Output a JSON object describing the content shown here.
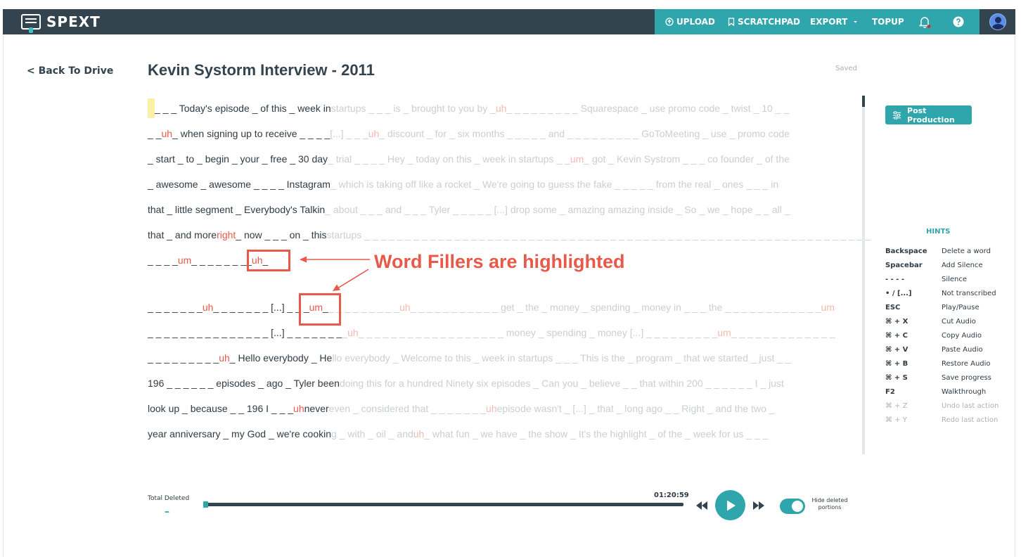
{
  "navbar": {
    "logo_text": "SPEXT",
    "upload_label": "UPLOAD",
    "scratchpad_label": "SCRATCHPAD",
    "export_label": "EXPORT",
    "topup_label": "TOPUP"
  },
  "back_link": "< Back To Drive",
  "doc_title": "Kevin Systorm Interview - 2011",
  "save_status": "Saved",
  "transcript": {
    "line1": {
      "dark": "_ _ _ Today's episode _ of this _ week in",
      "light_pre": " startups _ _ _ is _ brought to you by _ ",
      "filler": "uh",
      "light_post": " _ _ _ _ _ _ _ _ _ Squarespace _ use promo code _ twist _ 10 _ _"
    },
    "line2": {
      "dark_pre": "_ _ ",
      "filler": "uh",
      "dark_post": " _ when signing up to receive _ _ _ _",
      "light_pre": " [...] _ _ _ ",
      "filler_light": "uh",
      "light_post": " _ discount _ for _ six months _ _ _ _ _ and _ _ _ _ _ _ _ _ _ GoToMeeting _ use _ promo code"
    },
    "line3": {
      "dark": "_ start _ to _ begin _ your _ free _ 30 day",
      "light_pre": " _ trial _ _ _ _ Hey _ today on this _ week in startups _ _ ",
      "filler_light": "um",
      "light_post": " _ got _ Kevin Systrom _ _ _ co founder _ of the"
    },
    "line4": {
      "dark": "_ awesome _ awesome _ _ _ _ Instagram",
      "light": " _ which is taking off like a rocket _ We're going to guess the fake _ _ _ _ _ from the real _ ones _ _ _ in"
    },
    "line5": {
      "dark": "that _ little segment _ Everybody's Talkin",
      "light": " _ about _ _ _ and _ _ _ Tyler _ _ _ _ _ [...] drop some _ amazing amazing inside _ So _ we _ hope _ _ all _"
    },
    "line6": {
      "dark_pre": "that _ and more ",
      "filler": "right",
      "dark_post": " _ now _ _ _ on _ this",
      "light": " startups _ _ _ _ _ _ _ _ _ _ _ _ _ _ _ _ _ _ _ _ _ _ _ _ _ _ _ _ _ _ _ _ _ _ _ _ _ _ _ _ _ _ _ _ _ _ _ _ _ _ _ _ _ _ _ _ _ _ _ _ _ _"
    },
    "line7": {
      "dark_pre": "_ _ _ _ ",
      "filler1": "um",
      "dark_mid": " _ _ _ _ _ _ _ ",
      "dark_pre2": "_ ",
      "filler2": "uh",
      "dark_post": " _"
    },
    "line8": {
      "dark_pre": "_ _ _ _ _ _ _ ",
      "filler1": "uh",
      "dark_mid": " _ _ _ _ _ _ _ [...] _ _ _ ",
      "filler2": "um",
      "dark_post": " _",
      "light_pre": " _ _ _ _ _ _ _ _ _ ",
      "filler_light1": "uh",
      "light_mid": " _ _ _ _ _ _ _ _ _ _ _ get _ the _ money _ spending _ money in _ _ _ the _ _ _ _ _ _ _ _ _ _ _ _ ",
      "filler_light2": "um"
    },
    "line9": {
      "dark": "_ _ _ _ _ _ _ _ _ _ _ _ _ _ _ [...] _ _ _ _ _ _ _",
      "light_pre": " _ ",
      "filler_light1": "uh",
      "light_mid": " _ _ _ _ _ _ _ _ _ _ _ _ _ _ _ _ _ _ money _ spending _ money [...] _ _ _ _ _ _ _ _ _ ",
      "filler_light2": "um",
      "light_post": " _ _ _ _ _ _ _ _ _ _ _ _ _"
    },
    "line10": {
      "dark_pre": "_ _ _ _ _ _ _ _ _ ",
      "filler": "uh",
      "dark_post": " _ Hello everybody _ He",
      "light": "llo everybody _ Welcome to this _ week in startups _ _ _ This is the _ program _ that we started _ just _ _"
    },
    "line11": {
      "dark": "196 _ _ _ _ _ _ episodes _ ago _ Tyler been",
      "light": " doing this for a hundred Ninety six episodes _ Can you _ believe _ _ that within 200 _ _ _ _ _ _ I _ just"
    },
    "line12": {
      "dark_pre": "look up _ because _ _ 196 I _ _ _ ",
      "filler": "uh",
      "dark_post": " never",
      "light_pre": " even _ considered that _ _ _ _ _ _ _ ",
      "filler_light": "uh",
      "light_post": " episode wasn't _ [...] _ that _ long ago _ _ Right _ and the two _"
    },
    "line13": {
      "dark": "year anniversary _ my God _ we're cookin",
      "light_pre": "g _ with _ oil _ and ",
      "filler_light": "uh",
      "light_post": " _ what fun _ we have _ the show _ It's the highlight _ of the _ week for us _ _ _"
    }
  },
  "annotation": {
    "callout_text": "Word Fillers are highlighted"
  },
  "post_production_label": "Post Production",
  "hints": {
    "title": "HINTS",
    "rows": [
      {
        "key": "Backspace",
        "desc": "Delete a word"
      },
      {
        "key": "Spacebar",
        "desc": "Add Silence"
      },
      {
        "key": "- - - -",
        "desc": "Silence"
      },
      {
        "key": "• / [...]",
        "desc": "Not transcribed"
      },
      {
        "key": "ESC",
        "desc": "Play/Pause"
      },
      {
        "key": "⌘ + X",
        "desc": "Cut Audio"
      },
      {
        "key": "⌘ + C",
        "desc": "Copy Audio"
      },
      {
        "key": "⌘ + V",
        "desc": "Paste Audio"
      },
      {
        "key": "⌘ + B",
        "desc": "Restore Audio"
      },
      {
        "key": "⌘ + S",
        "desc": "Save progress"
      },
      {
        "key": "F2",
        "desc": "Walkthrough"
      },
      {
        "key": "⌘ + Z",
        "desc": "Undo last action"
      },
      {
        "key": "⌘ + Y",
        "desc": "Redo last action"
      }
    ]
  },
  "player": {
    "total_deleted_label": "Total Deleted",
    "total_deleted_value": "–",
    "time": "01:20:59",
    "progress": 0.0,
    "hide_deleted_label": "Hide deleted portions",
    "hide_deleted_on": true
  },
  "colors": {
    "navbar": "#34444e",
    "accent": "#2fa5ac",
    "filler": "#e8594a"
  }
}
